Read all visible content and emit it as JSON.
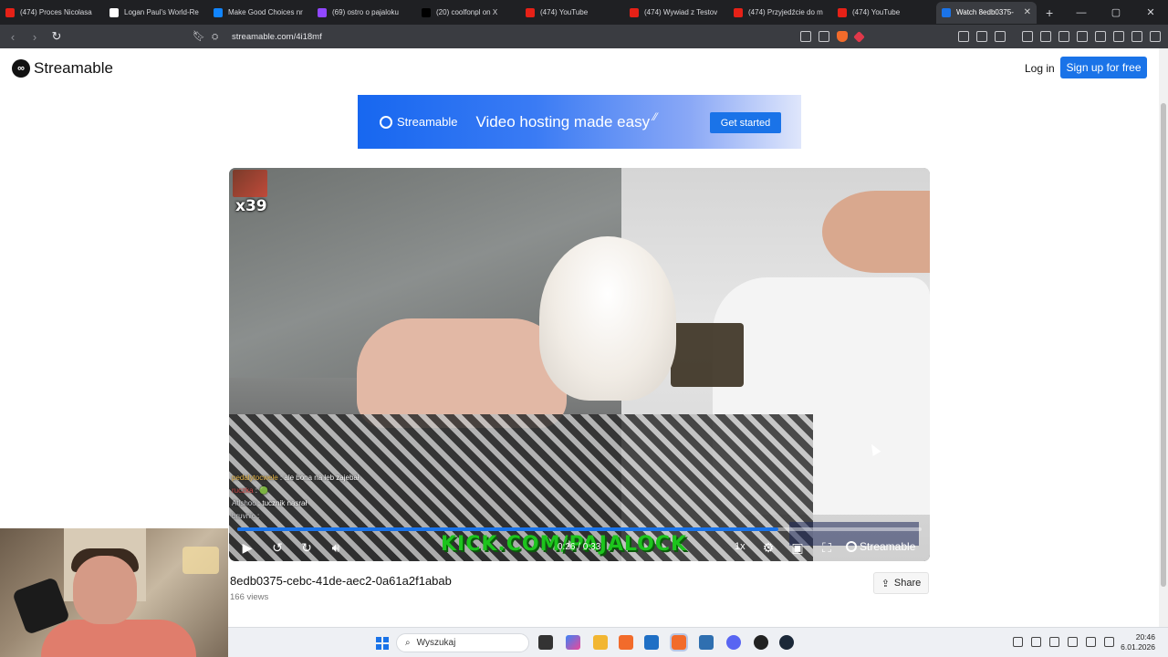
{
  "browser": {
    "tabs": [
      {
        "title": "(474) Proces Nicolasa",
        "icon": "youtube-icon",
        "color": "#e62117"
      },
      {
        "title": "Logan Paul's World-Re",
        "icon": "generic-site-icon",
        "color": "#ffffff"
      },
      {
        "title": "Make Good Choices nr",
        "icon": "bluesky-icon",
        "color": "#1185fe"
      },
      {
        "title": "(69) ostro o pajaloku",
        "icon": "twitch-icon",
        "color": "#9147ff"
      },
      {
        "title": "(20) coolfonpl on X",
        "icon": "x-icon",
        "color": "#000000"
      },
      {
        "title": "(474) YouTube",
        "icon": "youtube-icon",
        "color": "#e62117"
      },
      {
        "title": "(474) Wywiad z Testov",
        "icon": "youtube-icon",
        "color": "#e62117"
      },
      {
        "title": "(474) Przyjedźcie do m",
        "icon": "youtube-icon",
        "color": "#e62117"
      },
      {
        "title": "(474) YouTube",
        "icon": "youtube-icon",
        "color": "#e62117"
      },
      {
        "title": "Watch 8edb0375-",
        "icon": "streamable-icon",
        "color": "#1a73e8",
        "active": true
      }
    ],
    "new_tab": "+",
    "url": "streamable.com/4i18mf"
  },
  "site": {
    "logo": "Streamable",
    "login": "Log in",
    "signup": "Sign up for free"
  },
  "ad": {
    "logo": "Streamable",
    "tagline": "Video hosting made easy",
    "cta": "Get started"
  },
  "player": {
    "overlay_counter": "x39",
    "chat": [
      {
        "user": "pedalytocwele",
        "msg": " : ale bona na łeb zajebał",
        "color": "#e8b84a"
      },
      {
        "user": "ruczka",
        "msg": " : 🟢",
        "color": "#d24a4a"
      },
      {
        "user": "Atlshoo",
        "msg": " : tucznik nasrał",
        "color": "#cfd0d4"
      },
      {
        "user": "bruvnic",
        "msg": " :",
        "color": "#cfd0d4"
      }
    ],
    "overlay_text": "KICK.COM/PAJALOCK",
    "time": "0:26 / 0:33",
    "progress": 0.79,
    "speed": "1x",
    "watermark": "Streamable"
  },
  "video": {
    "title": "8edb0375-cebc-41de-aec2-0a61a2f1abab",
    "views": "166 views",
    "share": "Share"
  },
  "taskbar": {
    "search_placeholder": "Wyszukaj",
    "time": "20:46",
    "date": "6.01.2026"
  }
}
